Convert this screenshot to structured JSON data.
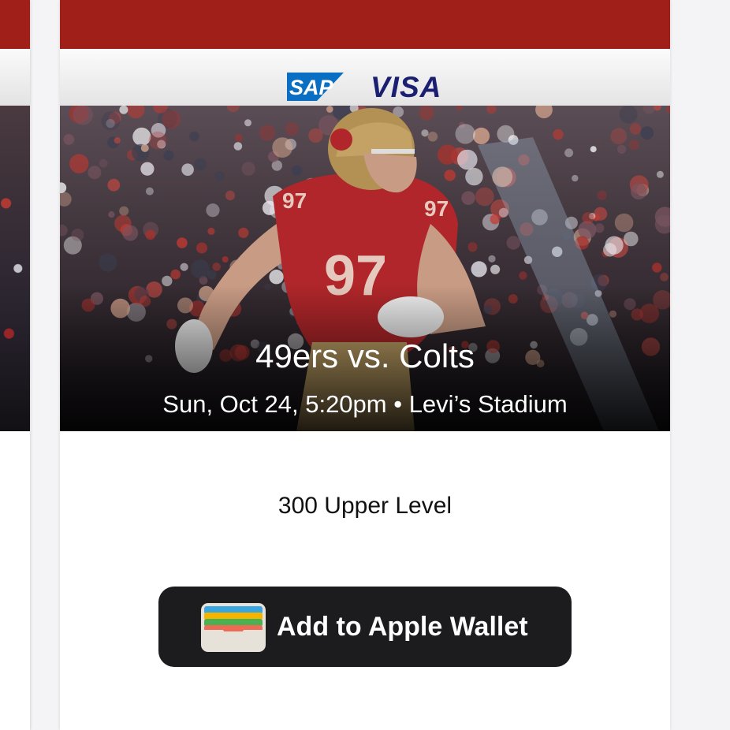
{
  "colors": {
    "team_red": "#a11f19",
    "sap_blue": "#0a6fc2",
    "visa_blue": "#1a1f71",
    "wallet_button_bg": "#1c1c1e"
  },
  "sponsors": {
    "sap_label": "SAP",
    "visa_label": "VISA"
  },
  "event": {
    "title": "49ers vs. Colts",
    "details": "Sun, Oct 24, 5:20pm • Levi’s Stadium",
    "jersey_number": "97"
  },
  "ticket": {
    "section": "300 Upper Level"
  },
  "wallet": {
    "button_label": "Add to Apple Wallet",
    "icon": "apple-wallet-icon"
  }
}
